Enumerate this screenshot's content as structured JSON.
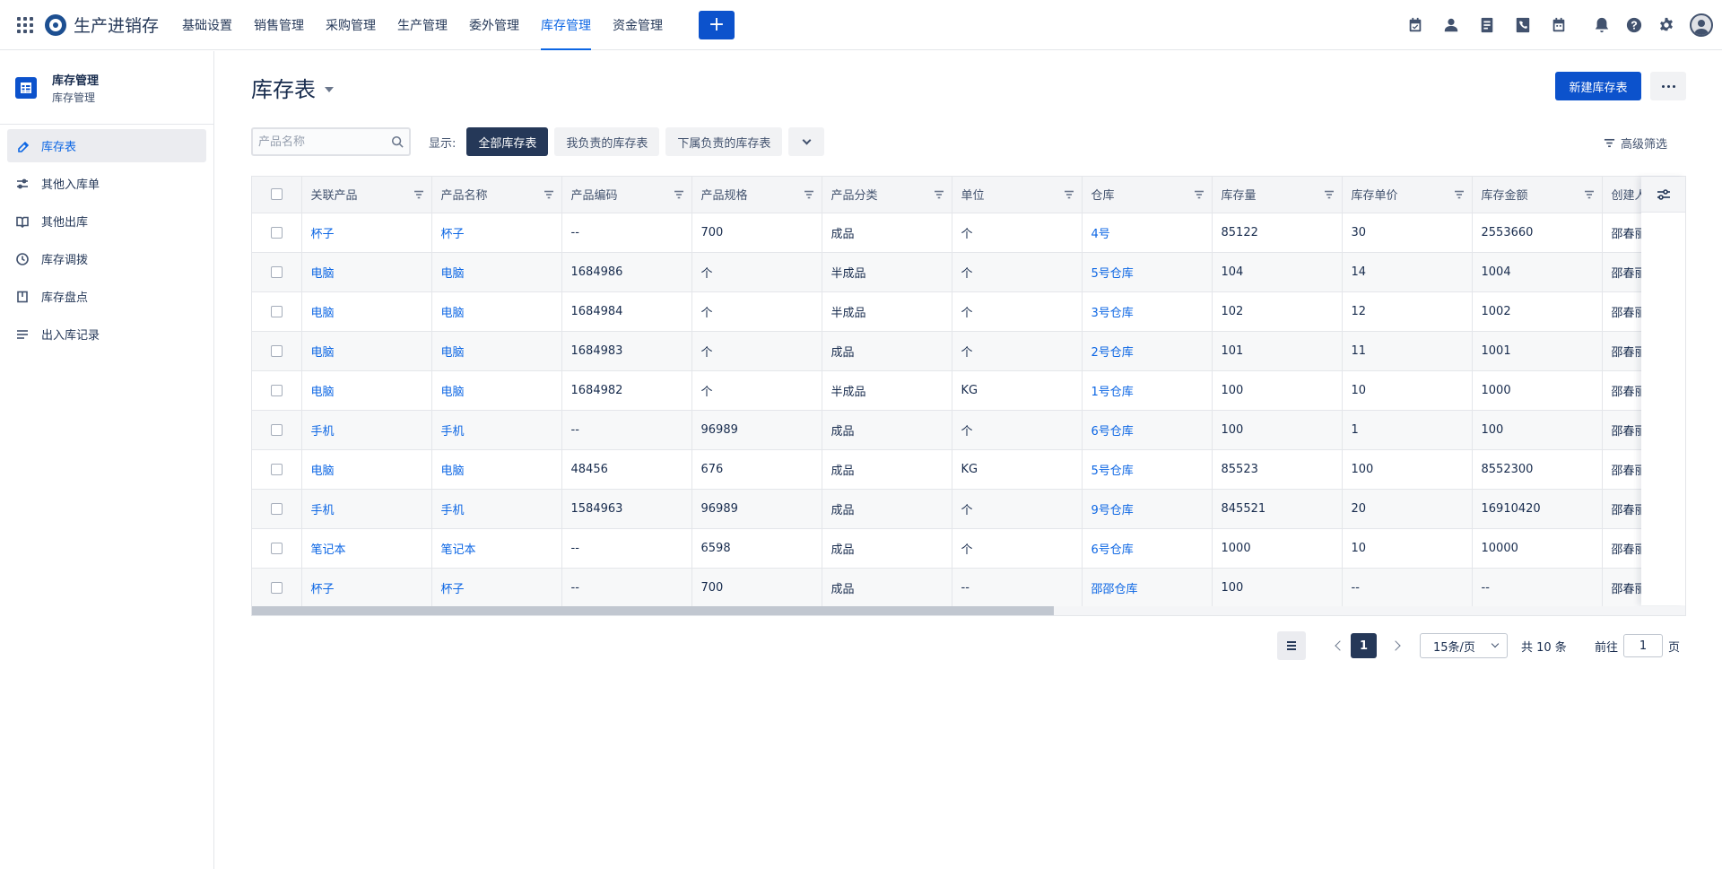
{
  "app": {
    "title": "生产进销存"
  },
  "topnav": {
    "items": [
      "基础设置",
      "销售管理",
      "采购管理",
      "生产管理",
      "委外管理",
      "库存管理",
      "资金管理"
    ],
    "active_index": 5,
    "plus_label": "+"
  },
  "sidebar": {
    "title": "库存管理",
    "subtitle": "库存管理",
    "items": [
      {
        "label": "库存表",
        "icon": "edit-icon"
      },
      {
        "label": "其他入库单",
        "icon": "sliders-icon"
      },
      {
        "label": "其他出库",
        "icon": "book-icon"
      },
      {
        "label": "库存调拨",
        "icon": "clock-icon"
      },
      {
        "label": "库存盘点",
        "icon": "ledger-icon"
      },
      {
        "label": "出入库记录",
        "icon": "list-icon"
      }
    ],
    "active_index": 0
  },
  "main": {
    "title": "库存表",
    "new_button": "新建库存表",
    "search_placeholder": "产品名称",
    "show_label": "显示:",
    "segments": [
      "全部库存表",
      "我负责的库存表",
      "下属负责的库存表"
    ],
    "active_segment": 0,
    "advanced_filter": "高级筛选"
  },
  "table": {
    "columns": [
      "关联产品",
      "产品名称",
      "产品编码",
      "产品规格",
      "产品分类",
      "单位",
      "仓库",
      "库存量",
      "库存单价",
      "库存金额",
      "创建人"
    ],
    "rows": [
      [
        "杯子",
        "杯子",
        "--",
        "700",
        "成品",
        "个",
        "4号",
        "85122",
        "30",
        "2553660",
        "邵春丽"
      ],
      [
        "电脑",
        "电脑",
        "1684986",
        "个",
        "半成品",
        "个",
        "5号仓库",
        "104",
        "14",
        "1004",
        "邵春丽"
      ],
      [
        "电脑",
        "电脑",
        "1684984",
        "个",
        "半成品",
        "个",
        "3号仓库",
        "102",
        "12",
        "1002",
        "邵春丽"
      ],
      [
        "电脑",
        "电脑",
        "1684983",
        "个",
        "成品",
        "个",
        "2号仓库",
        "101",
        "11",
        "1001",
        "邵春丽"
      ],
      [
        "电脑",
        "电脑",
        "1684982",
        "个",
        "半成品",
        "KG",
        "1号仓库",
        "100",
        "10",
        "1000",
        "邵春丽"
      ],
      [
        "手机",
        "手机",
        "--",
        "96989",
        "成品",
        "个",
        "6号仓库",
        "100",
        "1",
        "100",
        "邵春丽"
      ],
      [
        "电脑",
        "电脑",
        "48456",
        "676",
        "成品",
        "KG",
        "5号仓库",
        "85523",
        "100",
        "8552300",
        "邵春丽"
      ],
      [
        "手机",
        "手机",
        "1584963",
        "96989",
        "成品",
        "个",
        "9号仓库",
        "845521",
        "20",
        "16910420",
        "邵春丽"
      ],
      [
        "笔记本",
        "笔记本",
        "--",
        "6598",
        "成品",
        "个",
        "6号仓库",
        "1000",
        "10",
        "10000",
        "邵春丽"
      ],
      [
        "杯子",
        "杯子",
        "--",
        "700",
        "成品",
        "--",
        "邵邵仓库",
        "100",
        "--",
        "--",
        "邵春丽"
      ]
    ],
    "link_columns": [
      0,
      1,
      6
    ]
  },
  "pagination": {
    "current_page": "1",
    "page_size": "15条/页",
    "total": "共 10 条",
    "goto_label": "前往",
    "goto_value": "1",
    "page_suffix": "页"
  },
  "icons": {
    "top": [
      "calendar-check-icon",
      "contact-icon",
      "document-icon",
      "phone-icon",
      "calendar-icon",
      "bell-icon",
      "help-icon",
      "gear-icon",
      "user-avatar-icon"
    ]
  }
}
